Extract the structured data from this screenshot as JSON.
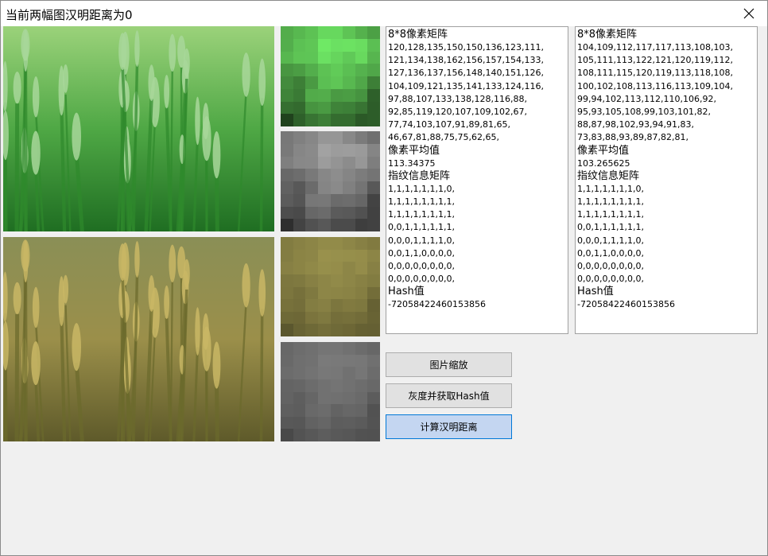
{
  "window": {
    "title": "当前两幅图汉明距离为0"
  },
  "left_panel": {
    "matrix_label": "8*8像素矩阵",
    "matrix_rows": [
      "120,128,135,150,150,136,123,111,",
      "121,134,138,162,156,157,154,133,",
      "127,136,137,156,148,140,151,126,",
      "104,109,121,135,141,133,124,116,",
      "97,88,107,133,138,128,116,88,",
      "92,85,119,120,107,109,102,67,",
      "77,74,103,107,91,89,81,65,",
      "46,67,81,88,75,75,62,65,"
    ],
    "mean_label": "像素平均值",
    "mean_value": "113.34375",
    "fingerprint_label": "指纹信息矩阵",
    "fingerprint_rows": [
      "1,1,1,1,1,1,1,0,",
      "1,1,1,1,1,1,1,1,",
      "1,1,1,1,1,1,1,1,",
      "0,0,1,1,1,1,1,1,",
      "0,0,0,1,1,1,1,0,",
      "0,0,1,1,0,0,0,0,",
      "0,0,0,0,0,0,0,0,",
      "0,0,0,0,0,0,0,0,"
    ],
    "hash_label": "Hash值",
    "hash_value": "-72058422460153856"
  },
  "right_panel": {
    "matrix_label": "8*8像素矩阵",
    "matrix_rows": [
      "104,109,112,117,117,113,108,103,",
      "105,111,113,122,121,120,119,112,",
      "108,111,115,120,119,113,118,108,",
      "100,102,108,113,116,113,109,104,",
      "99,94,102,113,112,110,106,92,",
      "95,93,105,108,99,103,101,82,",
      "88,87,98,102,93,94,91,83,",
      "73,83,88,93,89,87,82,81,"
    ],
    "mean_label": "像素平均值",
    "mean_value": "103.265625",
    "fingerprint_label": "指纹信息矩阵",
    "fingerprint_rows": [
      "1,1,1,1,1,1,1,0,",
      "1,1,1,1,1,1,1,1,",
      "1,1,1,1,1,1,1,1,",
      "0,0,1,1,1,1,1,1,",
      "0,0,0,1,1,1,1,0,",
      "0,0,1,1,0,0,0,0,",
      "0,0,0,0,0,0,0,0,",
      "0,0,0,0,0,0,0,0,"
    ],
    "hash_label": "Hash值",
    "hash_value": "-72058422460153856"
  },
  "buttons": {
    "zoom": "图片缩放",
    "gray_hash": "灰度并获取Hash值",
    "hamming": "计算汉明距离"
  },
  "colors": {
    "green_tint": "#4aa64a",
    "olive_tint": "#9a9350",
    "active_button": "#c4d6f1"
  },
  "icons": {
    "close": "close-icon"
  }
}
